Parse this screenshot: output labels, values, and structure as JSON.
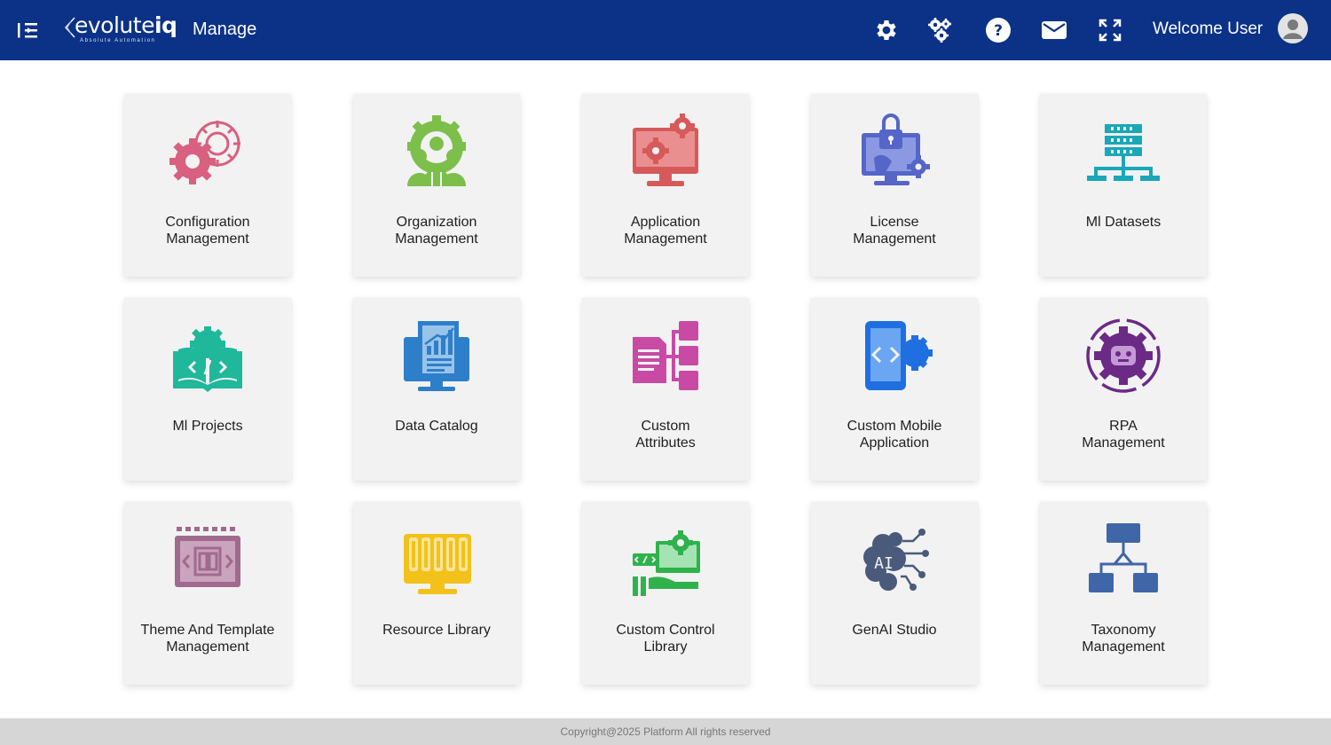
{
  "header": {
    "brand_main": "evolute",
    "brand_bold": "iq",
    "brand_tagline": "Absolute Automation",
    "page_title": "Manage",
    "icons": [
      "gear-icon",
      "multi-gear-icon",
      "help-icon",
      "mail-icon",
      "fullscreen-icon"
    ],
    "welcome": "Welcome User"
  },
  "tiles": [
    {
      "label": "Configuration\nManagement",
      "icon": "config-gears-icon",
      "color": "#d9607f"
    },
    {
      "label": "Organization\nManagement",
      "icon": "organization-icon",
      "color": "#7cbf4b"
    },
    {
      "label": "Application\nManagement",
      "icon": "application-monitor-icon",
      "color": "#d75a5a"
    },
    {
      "label": "License\nManagement",
      "icon": "license-lock-icon",
      "color": "#5566c8"
    },
    {
      "label": "Ml Datasets",
      "icon": "dataset-icon",
      "color": "#1aa7b8"
    },
    {
      "label": "Ml Projects",
      "icon": "ml-projects-book-icon",
      "color": "#1fb89a"
    },
    {
      "label": "Data Catalog",
      "icon": "data-catalog-icon",
      "color": "#2e7fc9"
    },
    {
      "label": "Custom\nAttributes",
      "icon": "custom-attributes-icon",
      "color": "#c94aa5"
    },
    {
      "label": "Custom Mobile\nApplication",
      "icon": "mobile-app-icon",
      "color": "#1f6fe0"
    },
    {
      "label": "RPA\nManagement",
      "icon": "rpa-robot-icon",
      "color": "#6b2a86"
    },
    {
      "label": "Theme And Template\nManagement",
      "icon": "theme-template-icon",
      "color": "#a06a8f"
    },
    {
      "label": "Resource Library",
      "icon": "resource-library-icon",
      "color": "#f2c21b"
    },
    {
      "label": "Custom Control\nLibrary",
      "icon": "custom-control-icon",
      "color": "#2fb24c"
    },
    {
      "label": "GenAI Studio",
      "icon": "genai-brain-icon",
      "color": "#4a5a7a"
    },
    {
      "label": "Taxonomy\nManagement",
      "icon": "taxonomy-tree-icon",
      "color": "#3f67a8"
    }
  ],
  "footer": {
    "text": "Copyright@2025 Platform All rights reserved"
  }
}
